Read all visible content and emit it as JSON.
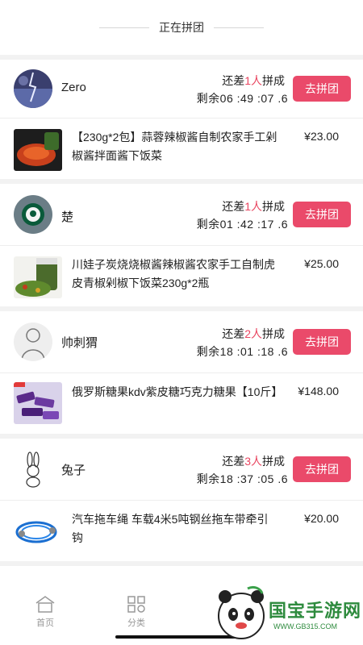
{
  "header": {
    "title": "正在拼团"
  },
  "groups": [
    {
      "user": "Zero",
      "need_prefix": "还差",
      "need_count": "1人",
      "need_suffix": "拼成",
      "remaining": "剩余06 :49 :07 .6",
      "button": "去拼团",
      "product_title": "【230g*2包】蒜蓉辣椒酱自制农家手工剁椒酱拌面酱下饭菜",
      "price": "¥23.00",
      "avatar_icon": "storm-avatar",
      "product_icon": "chili-sauce-image"
    },
    {
      "user": "楚",
      "need_prefix": "还差",
      "need_count": "1人",
      "need_suffix": "拼成",
      "remaining": "剩余01 :42 :17 .6",
      "button": "去拼团",
      "product_title": "川娃子炭烧烧椒酱辣椒酱农家手工自制虎皮青椒剁椒下饭菜230g*2瓶",
      "price": "¥25.00",
      "avatar_icon": "starbucks-avatar",
      "product_icon": "pepper-jar-image"
    },
    {
      "user": "帅刺猬",
      "need_prefix": "还差",
      "need_count": "2人",
      "need_suffix": "拼成",
      "remaining": "剩余18 :01 :18 .6",
      "button": "去拼团",
      "product_title": "俄罗斯糖果kdv紫皮糖巧克力糖果【10斤】",
      "price": "¥148.00",
      "avatar_icon": "sketch-avatar",
      "product_icon": "candy-image"
    },
    {
      "user": "兔子",
      "need_prefix": "还差",
      "need_count": "3人",
      "need_suffix": "拼成",
      "remaining": "剩余18 :37 :05 .6",
      "button": "去拼团",
      "product_title": "汽车拖车绳 车载4米5吨钢丝拖车带牵引钩",
      "price": "¥20.00",
      "avatar_icon": "rabbit-avatar",
      "product_icon": "tow-rope-image"
    }
  ],
  "tabs": [
    {
      "label": "首页",
      "icon": "home-icon"
    },
    {
      "label": "分类",
      "icon": "category-icon"
    }
  ],
  "watermark": {
    "text": "国宝手游网",
    "url": "WWW.GB315.COM"
  },
  "colors": {
    "accent": "#ea4a6a",
    "highlight": "#e94560",
    "separator": "#f2f2f2"
  }
}
